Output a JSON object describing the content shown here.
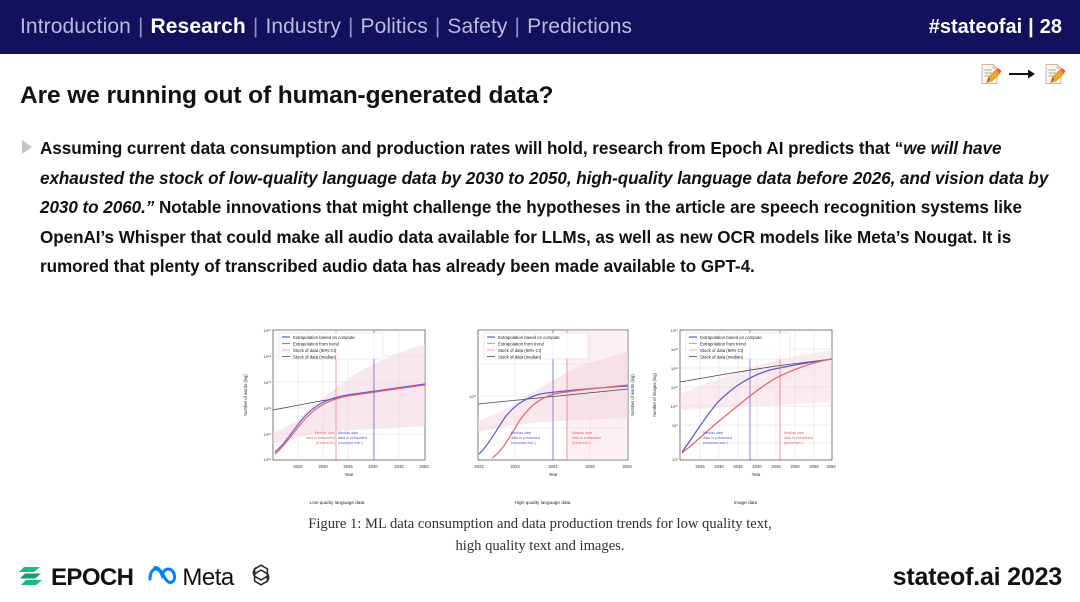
{
  "header": {
    "sections": [
      {
        "label": "Introduction",
        "active": false
      },
      {
        "label": "Research",
        "active": true
      },
      {
        "label": "Industry",
        "active": false
      },
      {
        "label": "Politics",
        "active": false
      },
      {
        "label": "Safety",
        "active": false
      },
      {
        "label": "Predictions",
        "active": false
      }
    ],
    "separator": "|",
    "hashtag": "#stateofai",
    "divider": "|",
    "page_number": "28",
    "bg_color": "#11115e",
    "active_color": "#ffffff",
    "inactive_color": "#b9bcdd"
  },
  "slide_nav": {
    "prev_icon": "memo-pencil-icon",
    "arrow_icon": "arrow-right-icon",
    "next_icon": "memo-pencil-icon"
  },
  "slide": {
    "title": "Are we running out of human-generated data?",
    "bullet_icon": "triangle-bullet-icon",
    "body": {
      "part1": "Assuming current data consumption and production rates will hold, research from Epoch AI predicts that “",
      "quote": "we will have exhausted the stock of low-quality language data by 2030 to 2050, high-quality language data before 2026, and vision data by 2030 to 2060.”",
      "part2": " Notable innovations that might challenge the hypotheses in the article are speech recognition systems like OpenAI’s Whisper that could make all audio data available for LLMs, as well as new OCR models like Meta’s Nougat. It is rumored that plenty of transcribed audio data has already been made available to GPT-4."
    },
    "figure_caption_line1": "Figure 1: ML data consumption and data production trends for low quality text,",
    "figure_caption_line2": "high quality text and images."
  },
  "footer": {
    "logos": [
      {
        "name": "epoch-logo",
        "text": "EPOCH",
        "color": "#0f9d73"
      },
      {
        "name": "meta-logo",
        "text": "Meta",
        "color": "#0082fb"
      },
      {
        "name": "openai-logo",
        "text": "",
        "color": "#111111"
      }
    ],
    "right_text": "stateof.ai 2023"
  },
  "chart_data": [
    {
      "type": "line",
      "title": "",
      "subcaption": "Low-quality language data",
      "xlabel": "Year",
      "ylabel": "Number of words (log)",
      "xlim": [
        2022,
        2050
      ],
      "ylim_log": [
        14,
        19
      ],
      "xticks": [
        "2025",
        "2030",
        "2035",
        "2040",
        "2045",
        "2050"
      ],
      "yticks": [
        "10^14",
        "10^15",
        "10^16",
        "10^17",
        "10^18",
        "10^19"
      ],
      "grid": true,
      "legend_position": "upper left",
      "legend": [
        {
          "label": "Extrapolation based on compute",
          "color": "#5b5bd6"
        },
        {
          "label": "Extrapolation from trend",
          "color": "#e8646a"
        },
        {
          "label": "Stock of data (90% CI)",
          "color": "#f2cfd8"
        },
        {
          "label": "Stock of data (median)",
          "color": "#333333"
        }
      ],
      "annotations": [
        {
          "text": "Median date data is exhausted (trend exh.)",
          "color": "#e8646a",
          "x": 2033
        },
        {
          "text": "Median date data is exhausted (compute exh.)",
          "color": "#5b5bd6",
          "x": 2040
        }
      ],
      "series": [
        {
          "name": "Extrapolation based on compute",
          "color": "#5b5bd6",
          "x": [
            2022,
            2024,
            2026,
            2028,
            2030,
            2034,
            2038,
            2042,
            2046,
            2050
          ],
          "y_log": [
            14.2,
            15.0,
            15.7,
            16.2,
            16.5,
            16.8,
            17.0,
            17.15,
            17.25,
            17.35
          ]
        },
        {
          "name": "Extrapolation from trend",
          "color": "#e8646a",
          "x": [
            2022,
            2024,
            2026,
            2028,
            2030,
            2034,
            2038,
            2042,
            2046,
            2050
          ],
          "y_log": [
            14.1,
            14.95,
            15.65,
            16.15,
            16.5,
            16.82,
            17.02,
            17.16,
            17.26,
            17.36
          ]
        },
        {
          "name": "Stock of data (median)",
          "color": "#333333",
          "x": [
            2022,
            2030,
            2040,
            2050
          ],
          "y_log": [
            16.35,
            16.7,
            17.05,
            17.4
          ]
        }
      ]
    },
    {
      "type": "line",
      "title": "",
      "subcaption": "High-quality language data",
      "xlabel": "Year",
      "ylabel": "Number of words (log)",
      "xlim": [
        2022,
        2026
      ],
      "ylim_log": [
        11,
        13
      ],
      "xticks": [
        "2022",
        "2023",
        "2024",
        "2025",
        "2026"
      ],
      "yticks": [
        "10^12"
      ],
      "grid": true,
      "legend_position": "upper left",
      "legend": [
        {
          "label": "Extrapolation based on compute",
          "color": "#5b5bd6"
        },
        {
          "label": "Extrapolation from trend",
          "color": "#e8a04a"
        },
        {
          "label": "Stock of data (90% CI)",
          "color": "#f2cfd8"
        },
        {
          "label": "Stock of data (median)",
          "color": "#333333"
        }
      ],
      "annotations": [
        {
          "text": "Median date data is exhausted (compute exh.)",
          "color": "#5b5bd6",
          "x": 2024.0
        },
        {
          "text": "Median date data is exhausted (trend exh.)",
          "color": "#e8646a",
          "x": 2024.6
        }
      ],
      "series": [
        {
          "name": "Extrapolation based on compute",
          "color": "#5b5bd6",
          "x": [
            2022,
            2022.5,
            2023,
            2023.5,
            2024,
            2024.5,
            2025,
            2025.5,
            2026
          ],
          "y_log": [
            11.15,
            11.6,
            12.0,
            12.25,
            12.4,
            12.5,
            12.57,
            12.62,
            12.66
          ]
        },
        {
          "name": "Extrapolation from trend",
          "color": "#e8646a",
          "x": [
            2022.4,
            2022.8,
            2023.2,
            2023.8,
            2024.3,
            2025,
            2025.6,
            2026
          ],
          "y_log": [
            11.1,
            11.5,
            11.9,
            12.3,
            12.5,
            12.6,
            12.65,
            12.68
          ]
        },
        {
          "name": "Stock of data (median)",
          "color": "#333333",
          "x": [
            2022,
            2026
          ],
          "y_log": [
            12.35,
            12.7
          ]
        }
      ]
    },
    {
      "type": "line",
      "title": "",
      "subcaption": "Image data",
      "xlabel": "Year",
      "ylabel": "Number of images (log)",
      "xlim": [
        2022,
        2060
      ],
      "ylim_log": [
        7,
        14
      ],
      "xticks": [
        "2025",
        "2030",
        "2035",
        "2040",
        "2045",
        "2050",
        "2055",
        "2060"
      ],
      "yticks": [
        "10^7",
        "10^9",
        "10^10",
        "10^11",
        "10^12",
        "10^13",
        "10^14"
      ],
      "grid": true,
      "legend_position": "upper left",
      "legend": [
        {
          "label": "Extrapolation based on compute",
          "color": "#5b5bd6"
        },
        {
          "label": "Extrapolation from trend",
          "color": "#d6b43c"
        },
        {
          "label": "Stock of data (90% CI)",
          "color": "#f2cfd8"
        },
        {
          "label": "Stock of data (median)",
          "color": "#333333"
        }
      ],
      "annotations": [
        {
          "text": "Median date data is exhausted (compute exh.)",
          "color": "#5b5bd6",
          "x": 2038
        },
        {
          "text": "Median date data is exhausted (trend exh.)",
          "color": "#e8646a",
          "x": 2046
        }
      ],
      "series": [
        {
          "name": "Extrapolation based on compute",
          "color": "#5b5bd6",
          "x": [
            2022,
            2026,
            2030,
            2034,
            2038,
            2042,
            2046,
            2050,
            2055,
            2060
          ],
          "y_log": [
            7.3,
            9.2,
            10.6,
            11.4,
            12.0,
            12.4,
            12.7,
            12.9,
            13.05,
            13.2
          ]
        },
        {
          "name": "Extrapolation from trend",
          "color": "#e8646a",
          "x": [
            2022,
            2026,
            2030,
            2034,
            2038,
            2042,
            2046,
            2050,
            2055,
            2060
          ],
          "y_log": [
            7.25,
            8.6,
            9.7,
            10.6,
            11.3,
            11.9,
            12.35,
            12.7,
            13.0,
            13.2
          ]
        },
        {
          "name": "Stock of data (median)",
          "color": "#333333",
          "x": [
            2022,
            2035,
            2050,
            2060
          ],
          "y_log": [
            11.45,
            12.1,
            12.8,
            13.2
          ]
        }
      ]
    }
  ]
}
